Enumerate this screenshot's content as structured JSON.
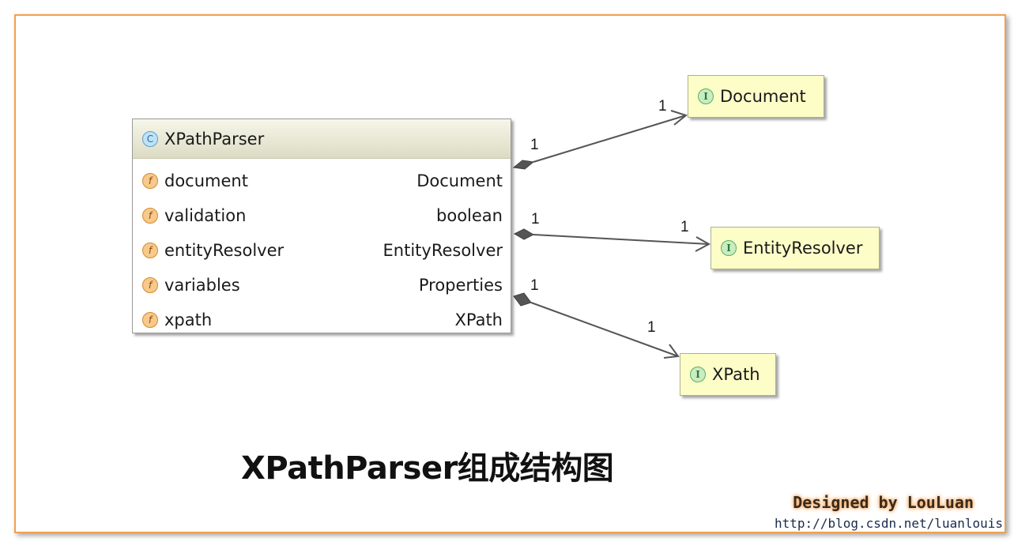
{
  "class": {
    "name": "XPathParser",
    "badge": "C",
    "fields": [
      {
        "badge": "f",
        "name": "document",
        "type": "Document"
      },
      {
        "badge": "f",
        "name": "validation",
        "type": "boolean"
      },
      {
        "badge": "f",
        "name": "entityResolver",
        "type": "EntityResolver"
      },
      {
        "badge": "f",
        "name": "variables",
        "type": "Properties"
      },
      {
        "badge": "f",
        "name": "xpath",
        "type": "XPath"
      }
    ]
  },
  "interfaces": [
    {
      "badge": "I",
      "name": "Document"
    },
    {
      "badge": "I",
      "name": "EntityResolver"
    },
    {
      "badge": "I",
      "name": "XPath"
    }
  ],
  "associations": [
    {
      "from": "XPathParser",
      "to": "Document",
      "source_multiplicity": "1",
      "target_multiplicity": "1",
      "kind": "composition"
    },
    {
      "from": "XPathParser",
      "to": "EntityResolver",
      "source_multiplicity": "1",
      "target_multiplicity": "1",
      "kind": "composition"
    },
    {
      "from": "XPathParser",
      "to": "XPath",
      "source_multiplicity": "1",
      "target_multiplicity": "1",
      "kind": "composition"
    }
  ],
  "caption": "XPathParser组成结构图",
  "credit": {
    "designer": "Designed by LouLuan",
    "url": "http://blog.csdn.net/luanlouis"
  },
  "colors": {
    "frame_border": "#f0a050",
    "class_header": "#dcdcc4",
    "interface_fill": "#fdfdc8",
    "class_badge": "#bfe2f6",
    "field_badge": "#f7c98a",
    "interface_badge": "#c9ecc4",
    "credit_glow": "#f5a860"
  },
  "icons": {
    "class": "class-icon",
    "field": "field-icon",
    "interface": "interface-icon"
  }
}
